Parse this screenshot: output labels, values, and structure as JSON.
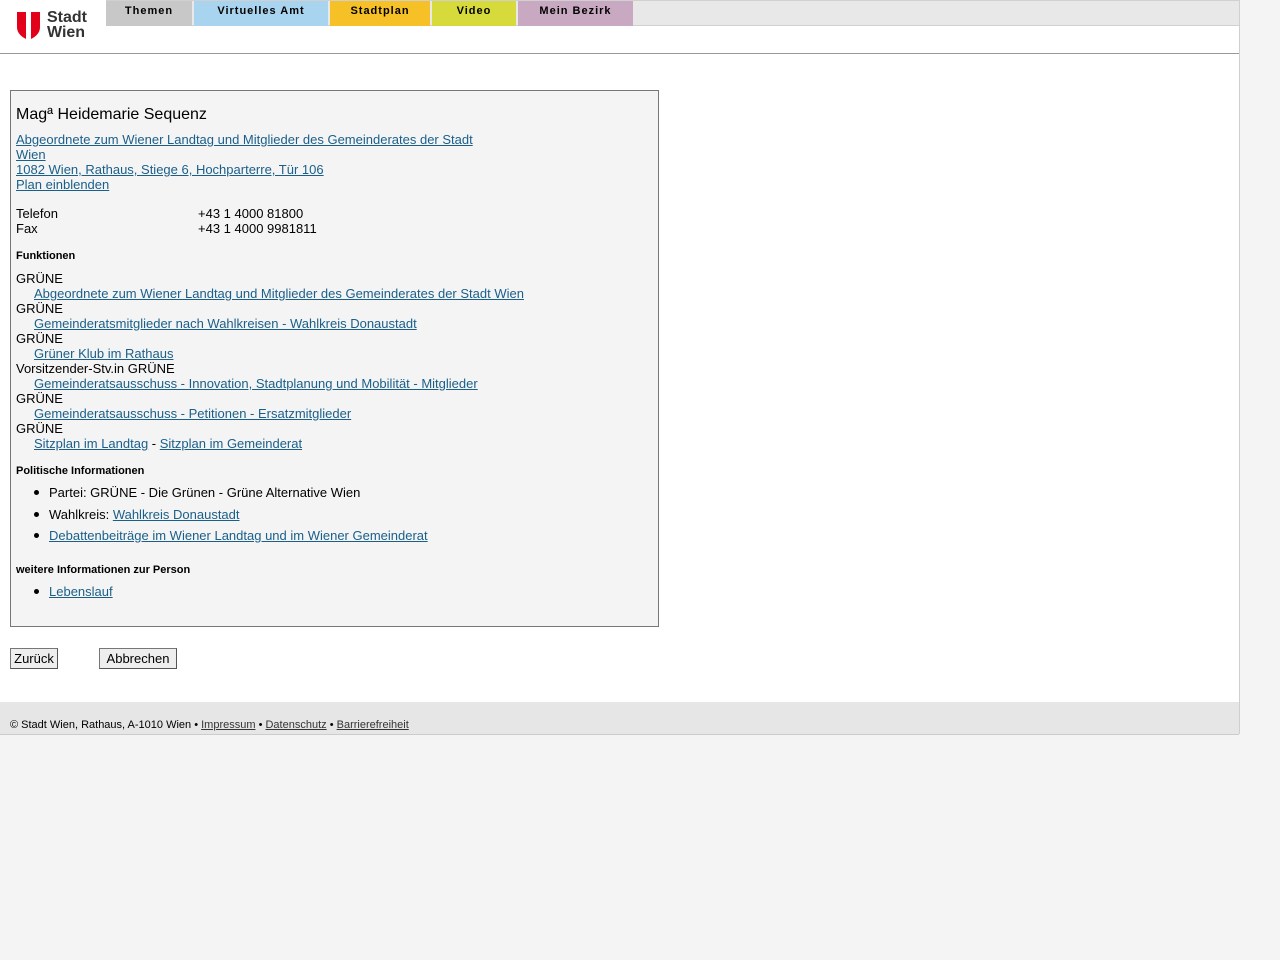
{
  "logo": {
    "text_line1": "Stadt",
    "text_line2": "Wien",
    "icon": "wien-coat-of-arms-icon",
    "shield_color": "#e2001a"
  },
  "nav": {
    "tabs": [
      {
        "label": "Themen",
        "color": "#c8c8c8"
      },
      {
        "label": "Virtuelles Amt",
        "color": "#a9d4ef"
      },
      {
        "label": "Stadtplan",
        "color": "#f5c127"
      },
      {
        "label": "Video",
        "color": "#d6da3a"
      },
      {
        "label": "Mein Bezirk",
        "color": "#c9a9c1"
      }
    ]
  },
  "person": {
    "name": "Magª Heidemarie Sequenz",
    "role_link_line1": "Abgeordnete zum Wiener Landtag und Mitglieder des Gemeinderates der Stadt",
    "role_link_line2": "Wien",
    "address_link": "1082 Wien, Rathaus, Stiege 6, Hochparterre, Tür 106",
    "map_link": "Plan einblenden",
    "contact": [
      {
        "label": "Telefon",
        "value": "+43 1 4000 81800"
      },
      {
        "label": "Fax",
        "value": "+43 1 4000 9981811"
      }
    ]
  },
  "funktionen": {
    "heading": "Funktionen",
    "items": [
      {
        "party": "GRÜNE",
        "link": "Abgeordnete zum Wiener Landtag und Mitglieder des Gemeinderates der Stadt Wien"
      },
      {
        "party": "GRÜNE",
        "link": "Gemeinderatsmitglieder nach Wahlkreisen - Wahlkreis Donaustadt"
      },
      {
        "party": "GRÜNE",
        "link": "Grüner Klub im Rathaus"
      },
      {
        "party": "Vorsitzender-Stv.in GRÜNE",
        "link": "Gemeinderatsausschuss - Innovation, Stadtplanung und Mobilität - Mitglieder"
      },
      {
        "party": "GRÜNE",
        "link": "Gemeinderatsausschuss - Petitionen - Ersatzmitglieder"
      }
    ],
    "last_party": "GRÜNE",
    "sitzplan_landtag": "Sitzplan im Landtag",
    "sitzplan_separator": " - ",
    "sitzplan_gemeinderat": "Sitzplan im Gemeinderat"
  },
  "politik": {
    "heading": "Politische Informationen",
    "partei": "Partei: GRÜNE - Die Grünen - Grüne Alternative Wien",
    "wahlkreis_label": "Wahlkreis: ",
    "wahlkreis_link": "Wahlkreis Donaustadt",
    "debatten_link": "Debattenbeiträge im Wiener Landtag und im Wiener Gemeinderat"
  },
  "weitere": {
    "heading": "weitere Informationen zur Person",
    "lebenslauf_link": "Lebenslauf"
  },
  "buttons": {
    "back": "Zurück",
    "cancel": "Abbrechen"
  },
  "footer": {
    "copyright": "© Stadt Wien, Rathaus, A-1010 Wien • ",
    "impressum": "Impressum",
    "sep": " • ",
    "datenschutz": "Datenschutz",
    "barrierefreiheit": "Barrierefreiheit"
  }
}
